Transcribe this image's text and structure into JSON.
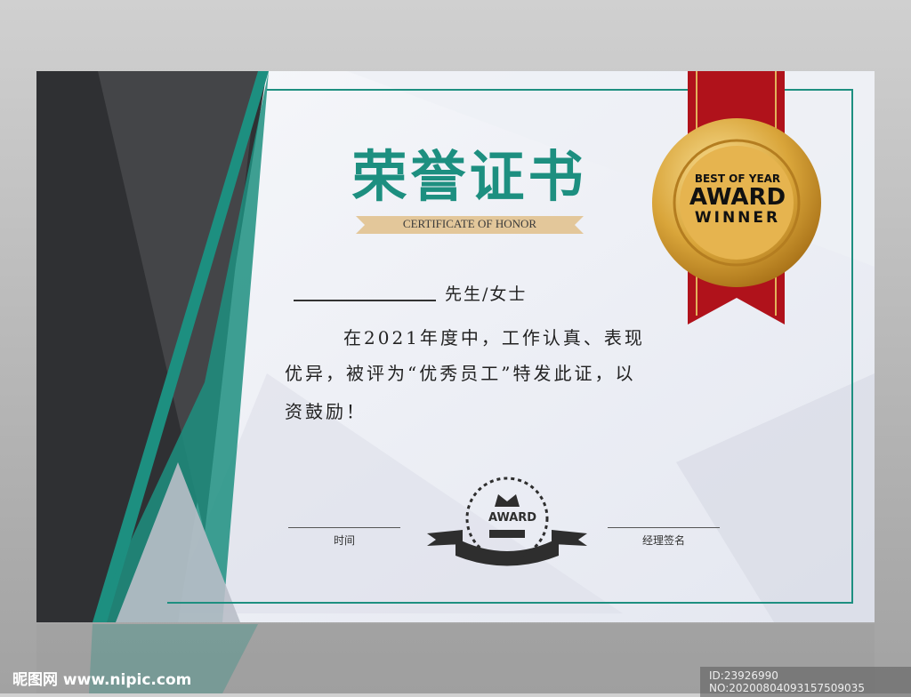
{
  "certificate": {
    "title": "荣誉证书",
    "subtitle": "CERTIFICATE OF HONOR",
    "salutation": "先生/女士",
    "body_lines": [
      "在2021年度中，工作认真、表现",
      "优异，被评为“优秀员工”特发此证，以",
      "资鼓励！"
    ],
    "date_label": "时间",
    "signature_label": "经理签名",
    "emblem_text": "AWARD",
    "medal": {
      "line1": "BEST OF YEAR",
      "line2": "AWARD",
      "line3": "WINNER"
    },
    "colors": {
      "teal": "#1d8f80",
      "dark": "#333333",
      "gold": "#d9a53a",
      "red": "#b0121b"
    }
  },
  "watermark": {
    "site": "昵图网 www.nipic.com",
    "id_text": "ID:23926990 NO:20200804093157509035"
  }
}
